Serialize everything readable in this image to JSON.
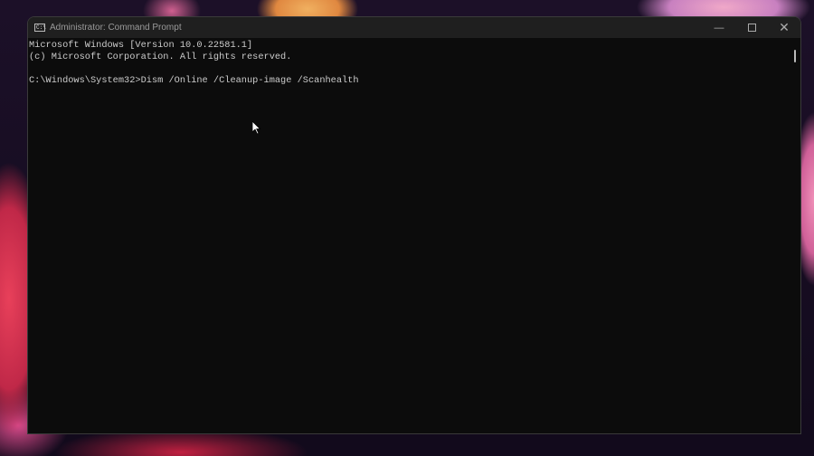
{
  "window": {
    "title": "Administrator: Command Prompt",
    "icon": "cmd-icon"
  },
  "controls": {
    "minimize": "minimize-icon",
    "maximize": "maximize-icon",
    "close": "close-icon"
  },
  "console": {
    "lines": [
      "Microsoft Windows [Version 10.0.22581.1]",
      "(c) Microsoft Corporation. All rights reserved.",
      "",
      "C:\\Windows\\System32>Dism /Online /Cleanup-image /Scanhealth"
    ]
  }
}
